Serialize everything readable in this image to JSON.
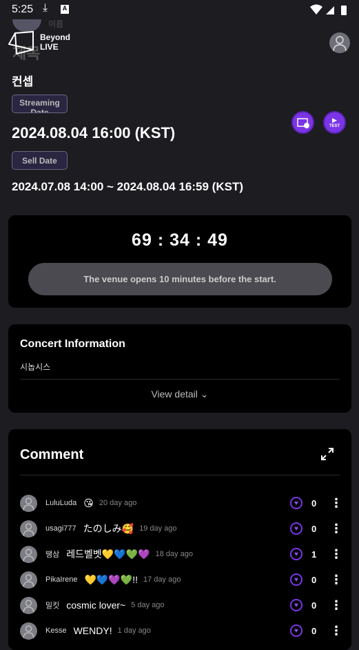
{
  "status_bar": {
    "time": "5:25"
  },
  "header": {
    "logo_line1": "Beyond",
    "logo_line2": "LIVE",
    "faded_title": "제목",
    "faded_sub": "이름"
  },
  "event": {
    "title": "컨셉",
    "streaming_label": "Streaming Date",
    "streaming_date": "2024.08.04 16:00 (KST)",
    "sell_label": "Sell Date",
    "sell_date": "2024.07.08 14:00 ~ 2024.08.04 16:59 (KST)",
    "test_label": "TEST"
  },
  "countdown": {
    "h": "69",
    "m": "34",
    "s": "49",
    "sep": ":",
    "notice": "The venue opens 10 minutes before the start."
  },
  "info": {
    "title": "Concert Information",
    "synopsis": "시놉시스",
    "view_detail": "View detail"
  },
  "comments": {
    "title": "Comment",
    "items": [
      {
        "user": "LuluLuda",
        "text": "😘",
        "ago": "20 day ago",
        "likes": "0"
      },
      {
        "user": "usagi777",
        "text": "たのしみ🥰",
        "ago": "19 day ago",
        "likes": "0"
      },
      {
        "user": "땡삼",
        "text": "레드벨벳💛💙💚💜",
        "ago": "18 day ago",
        "likes": "1"
      },
      {
        "user": "PikaIrene",
        "text": "💛💙💜💚!!",
        "ago": "17 day ago",
        "likes": "0"
      },
      {
        "user": "밀킷",
        "text": "cosmic lover~",
        "ago": "5 day ago",
        "likes": "0"
      },
      {
        "user": "Kesse",
        "text": "WENDY!",
        "ago": "1 day ago",
        "likes": "0"
      }
    ]
  },
  "colors": {
    "accent": "#7a35e6",
    "background": "#1c1c21",
    "card": "#000000"
  }
}
